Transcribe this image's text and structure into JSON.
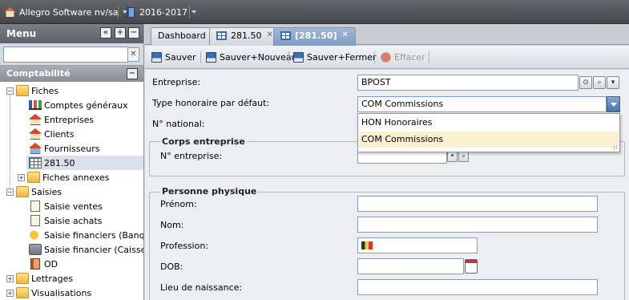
{
  "topbar": {
    "company": "Allegro Software nv/sa",
    "year": "2016-2017"
  },
  "menu": {
    "title": "Menu",
    "search_value": "",
    "clear_glyph": "✕",
    "collapse_glyph": "«",
    "expand_glyph": "+",
    "minimize_glyph": "−",
    "section": "Comptabilité",
    "tree": {
      "fiches": "Fiches",
      "comptes": "Comptes généraux",
      "entreprises": "Entreprises",
      "clients": "Clients",
      "fournisseurs": "Fournisseurs",
      "f28150": "281.50",
      "fiches_annexes": "Fiches annexes",
      "saisies": "Saisies",
      "saisie_ventes": "Saisie ventes",
      "saisie_achats": "Saisie achats",
      "saisie_fin_banque": "Saisie financiers (Banque",
      "saisie_fin_caisses": "Saisie financier (Caisses)",
      "od": "OD",
      "lettrages": "Lettrages",
      "visualisations": "Visualisations"
    },
    "expander_minus": "−",
    "expander_plus": "+"
  },
  "tabs": {
    "dashboard": "Dashboard",
    "tab2": "281.50",
    "tab3": "[281.50]",
    "close_glyph": "✕"
  },
  "toolbar": {
    "save": "Sauver",
    "save_new": "Sauver+Nouveau",
    "save_close": "Sauver+Fermer",
    "delete": "Effacer"
  },
  "form": {
    "entreprise_label": "Entreprise:",
    "entreprise_value": "BPOST",
    "type_label": "Type honoraire par défaut:",
    "type_value": "COM Commissions",
    "national_label": "N° national:",
    "corps_legend": "Corps entreprise",
    "n_entreprise_label": "N° entreprise:",
    "personne_legend": "Personne physique",
    "prenom_label": "Prénom:",
    "nom_label": "Nom:",
    "profession_label": "Profession:",
    "dob_label": "DOB:",
    "lieu_label": "Lieu de naissance:"
  },
  "dropdown": {
    "options": [
      "HON Honoraires",
      "COM Commissions"
    ]
  },
  "colors": {
    "accent": "#7f9bc2",
    "highlight": "#fbf0d2"
  }
}
